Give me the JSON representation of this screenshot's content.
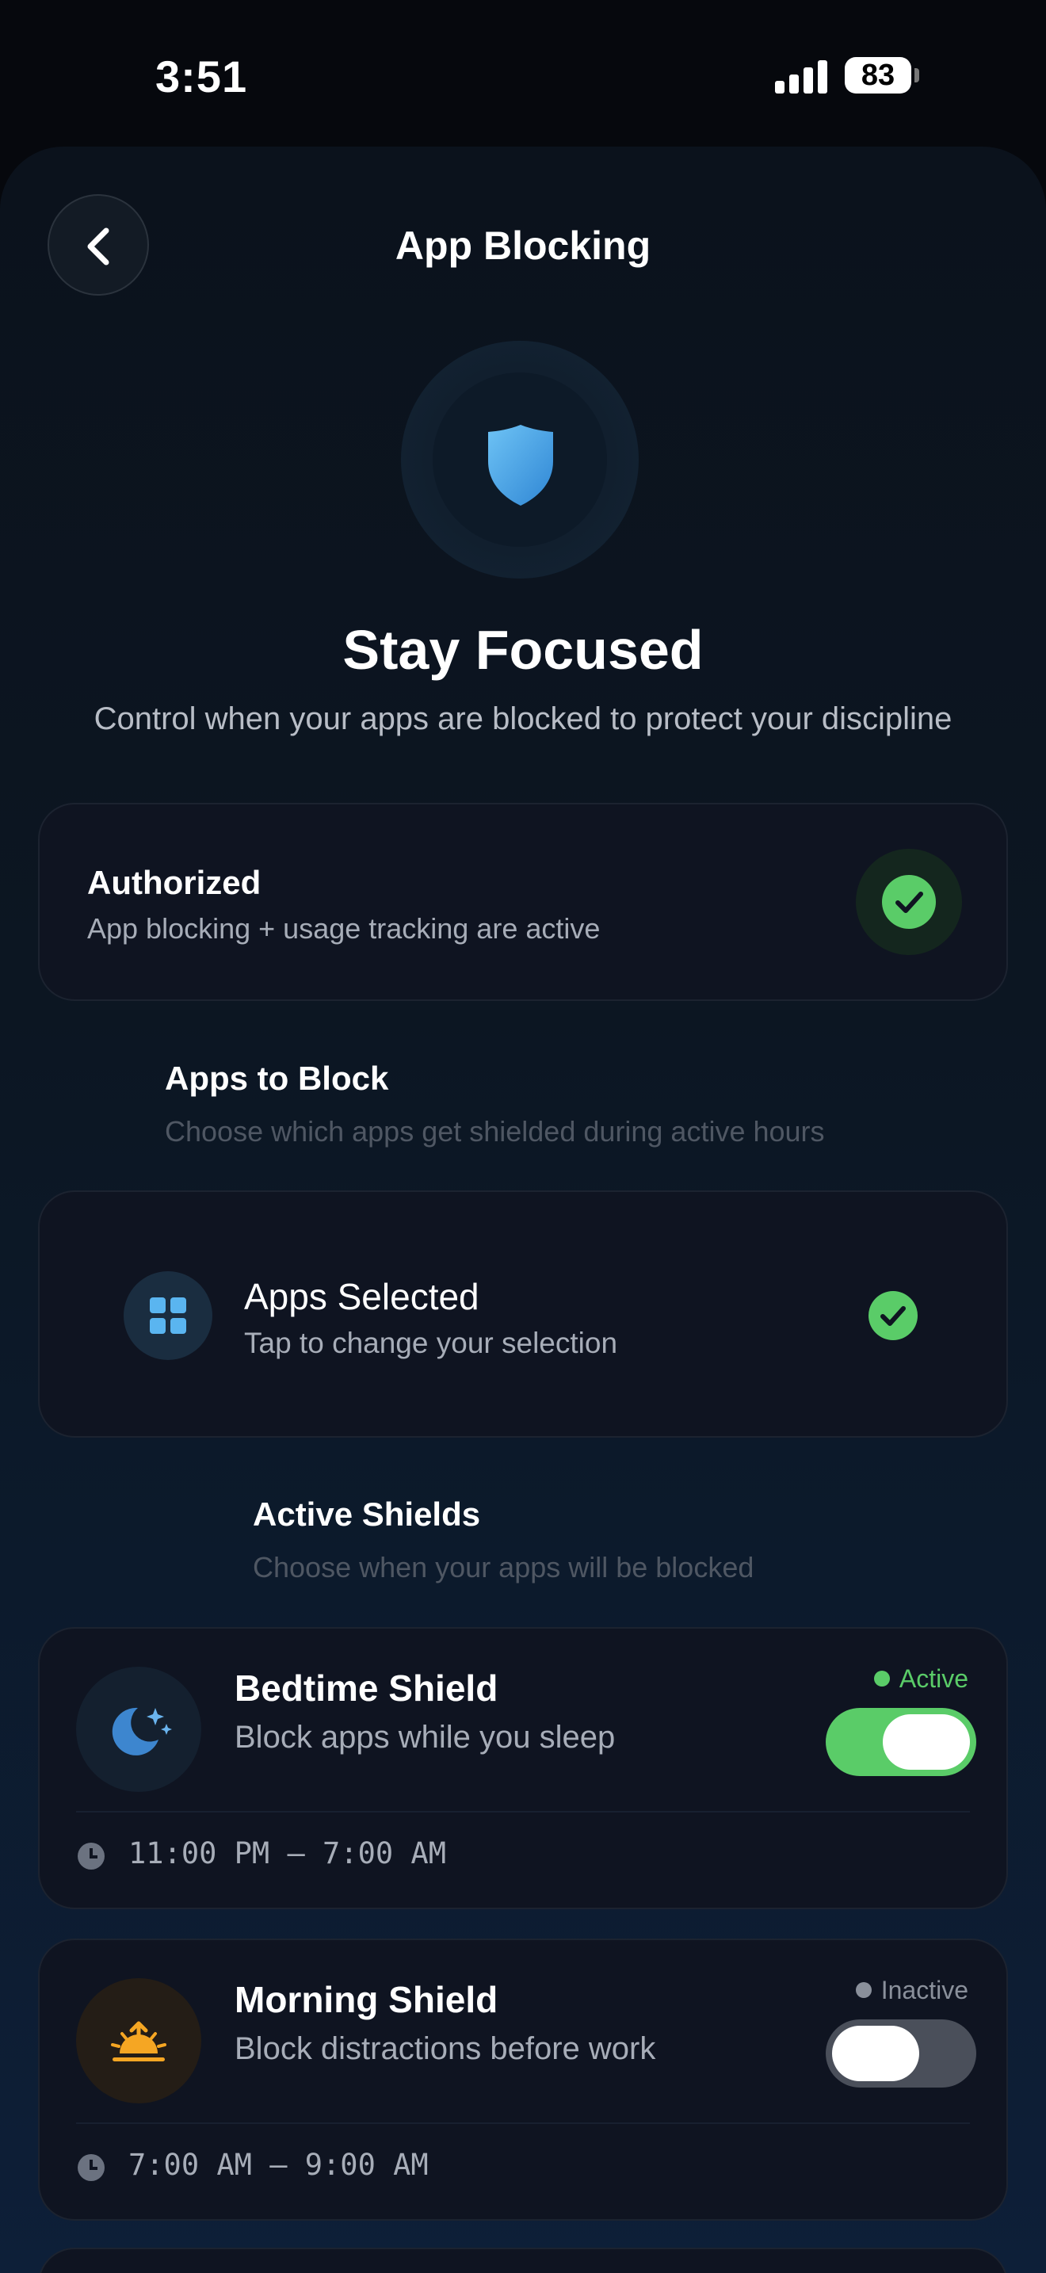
{
  "status_bar": {
    "time": "3:51",
    "battery": "83"
  },
  "header": {
    "title": "App Blocking"
  },
  "hero": {
    "title": "Stay Focused",
    "subtitle": "Control when your apps are blocked to protect your discipline"
  },
  "authorization": {
    "title": "Authorized",
    "subtitle": "App blocking + usage tracking are active"
  },
  "apps_section": {
    "title": "Apps to Block",
    "subtitle": "Choose which apps get shielded during active hours",
    "card_title": "Apps Selected",
    "card_subtitle": "Tap to change your selection"
  },
  "shields_section": {
    "title": "Active Shields",
    "subtitle": "Choose when your apps will be blocked"
  },
  "shields": [
    {
      "title": "Bedtime Shield",
      "description": "Block apps while you sleep",
      "status": "Active",
      "enabled": true,
      "time_range": "11:00 PM – 7:00 AM",
      "icon": "moon-stars-icon"
    },
    {
      "title": "Morning Shield",
      "description": "Block distractions before work",
      "status": "Inactive",
      "enabled": false,
      "time_range": "7:00 AM – 9:00 AM",
      "icon": "sunrise-icon"
    }
  ],
  "colors": {
    "accent_green": "#5acc68",
    "accent_blue": "#4a9fe0",
    "accent_orange": "#f5a623",
    "background": "#06080d",
    "card": "#0f1421"
  }
}
